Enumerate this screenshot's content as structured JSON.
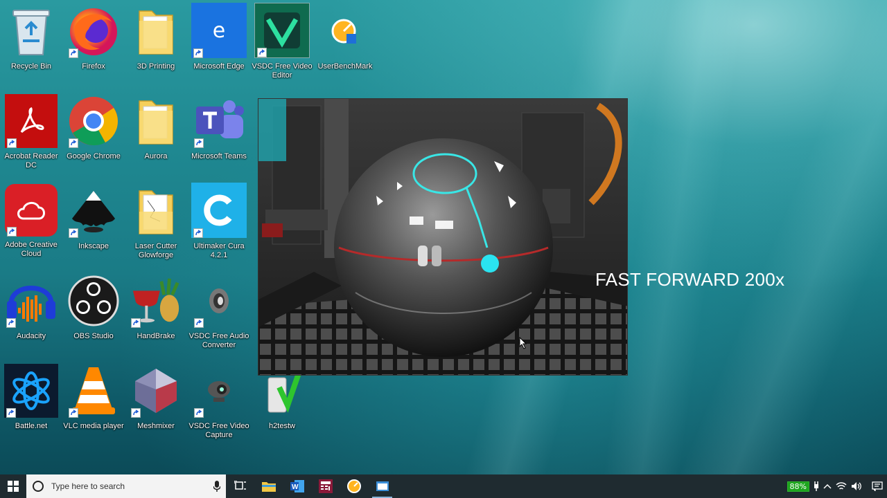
{
  "desktop": {
    "icons": [
      {
        "label": "Recycle Bin"
      },
      {
        "label": "Firefox"
      },
      {
        "label": "3D Printing"
      },
      {
        "label": "Microsoft Edge"
      },
      {
        "label": "VSDC Free Video Editor"
      },
      {
        "label": "UserBenchMark"
      },
      {
        "label": "Acrobat Reader DC"
      },
      {
        "label": "Google Chrome"
      },
      {
        "label": "Aurora"
      },
      {
        "label": "Microsoft Teams"
      },
      {
        "label": "Adobe Creative Cloud"
      },
      {
        "label": "Inkscape"
      },
      {
        "label": "Laser Cutter Glowforge"
      },
      {
        "label": "Ultimaker Cura 4.2.1"
      },
      {
        "label": "Audacity"
      },
      {
        "label": "OBS Studio"
      },
      {
        "label": "HandBrake"
      },
      {
        "label": "VSDC Free Audio Converter"
      },
      {
        "label": "Battle.net"
      },
      {
        "label": "VLC media player"
      },
      {
        "label": "Meshmixer"
      },
      {
        "label": "VSDC Free Video Capture"
      },
      {
        "label": "h2testw"
      }
    ]
  },
  "overlay": {
    "text": "FAST FORWARD 200x"
  },
  "taskbar": {
    "search_placeholder": "Type here to search",
    "battery_percent": "88%"
  },
  "colors": {
    "taskbar_bg": "#1f2b30",
    "battery_green": "#1ea51e",
    "desktop_teal": "#1f8891"
  }
}
